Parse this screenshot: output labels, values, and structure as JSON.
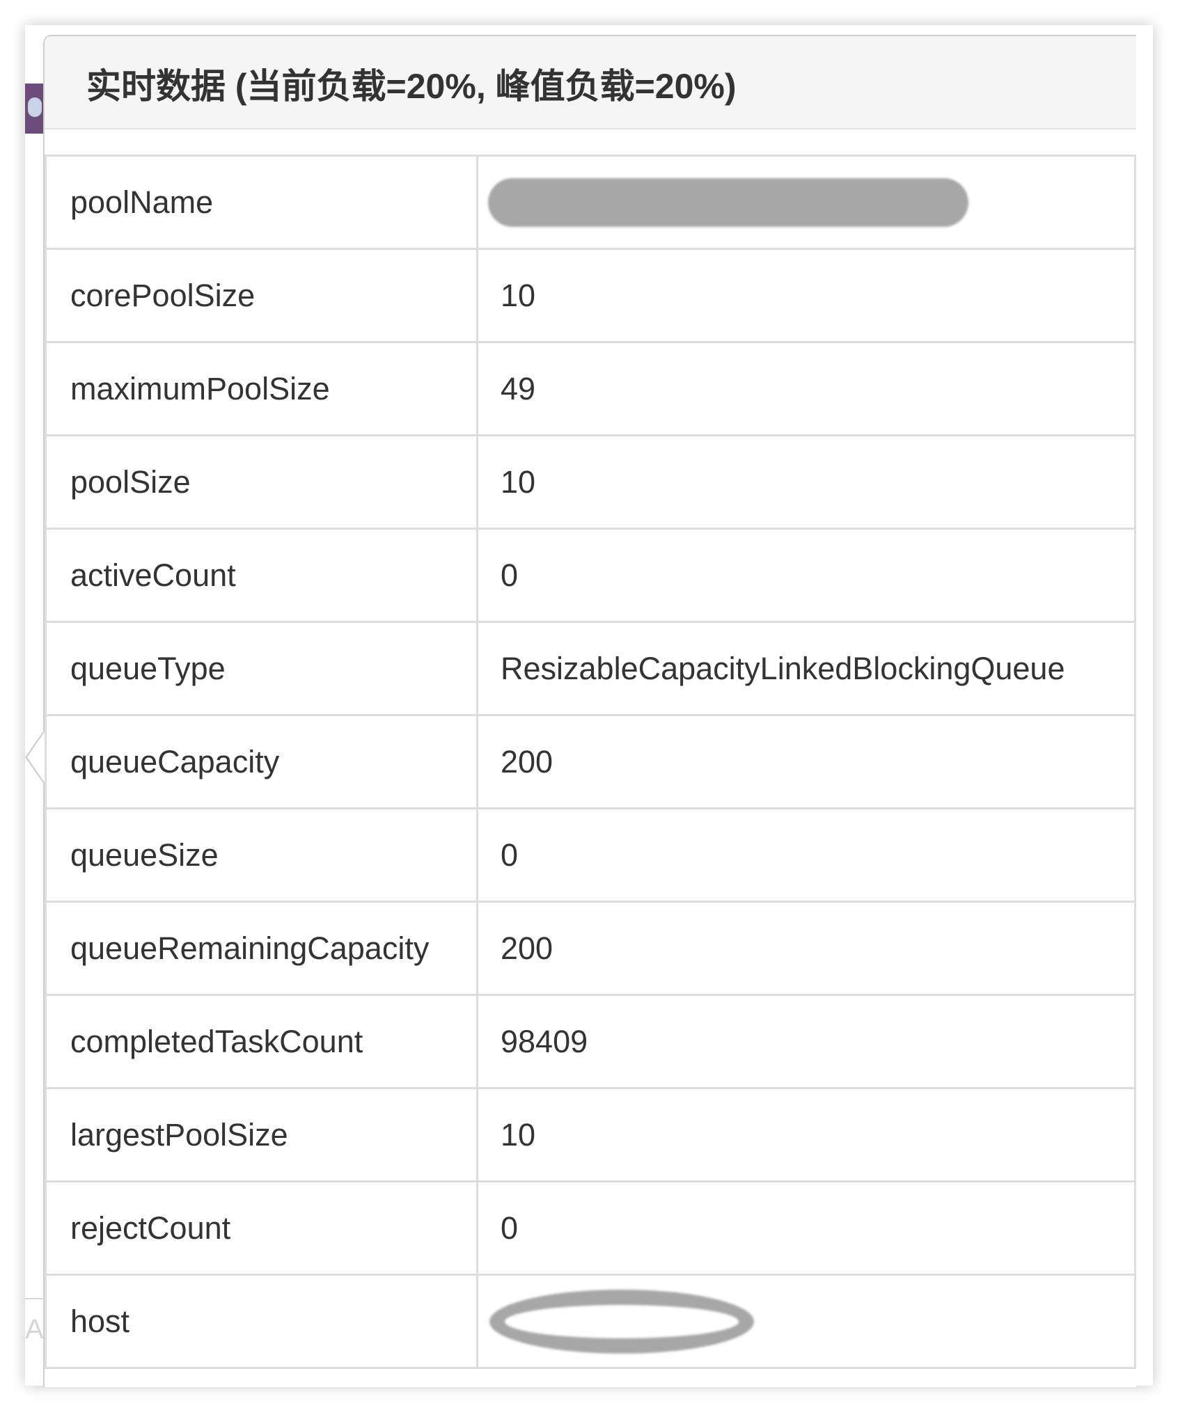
{
  "popover": {
    "title": "实时数据 (当前负载=20%, 峰值负载=20%)"
  },
  "background": {
    "fragment_letter": "A"
  },
  "rows": [
    {
      "key": "poolName",
      "value": "",
      "redacted": true
    },
    {
      "key": "corePoolSize",
      "value": "10"
    },
    {
      "key": "maximumPoolSize",
      "value": "49"
    },
    {
      "key": "poolSize",
      "value": "10"
    },
    {
      "key": "activeCount",
      "value": "0"
    },
    {
      "key": "queueType",
      "value": "ResizableCapacityLinkedBlockingQueue"
    },
    {
      "key": "queueCapacity",
      "value": "200"
    },
    {
      "key": "queueSize",
      "value": "0"
    },
    {
      "key": "queueRemainingCapacity",
      "value": "200"
    },
    {
      "key": "completedTaskCount",
      "value": "98409"
    },
    {
      "key": "largestPoolSize",
      "value": "10"
    },
    {
      "key": "rejectCount",
      "value": "0"
    },
    {
      "key": "host",
      "value": "",
      "redacted": true
    }
  ],
  "colors": {
    "header_bg": "#f5f5f5",
    "border": "#dddddd",
    "text": "#333333",
    "redaction": "#a3a3a3"
  }
}
